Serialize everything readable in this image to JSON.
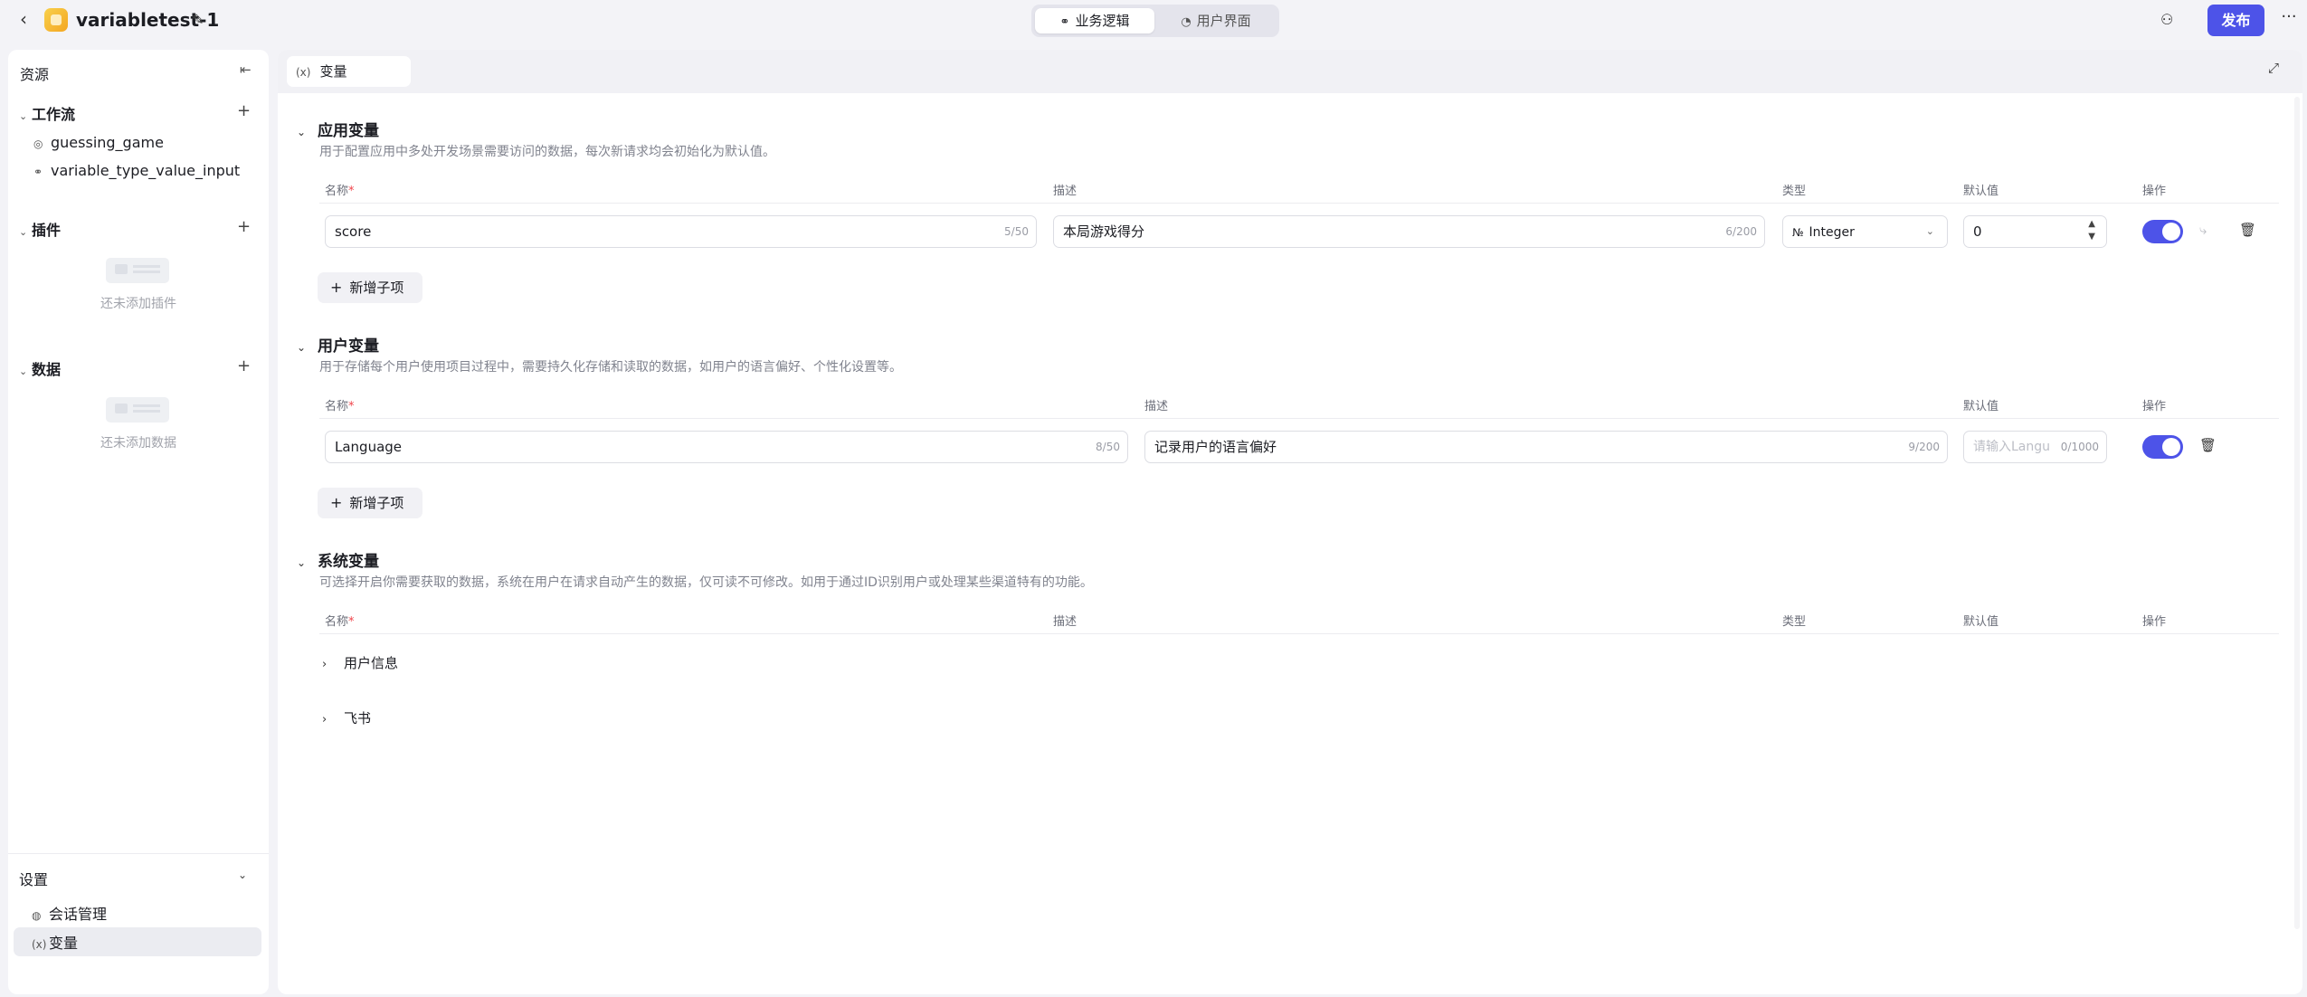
{
  "header": {
    "back": "‹",
    "app_title": "variabletest-1",
    "tabs": [
      {
        "label": "业务逻辑",
        "icon": "workflow-icon"
      },
      {
        "label": "用户界面",
        "icon": "palette-icon"
      }
    ],
    "publish_label": "发布",
    "more": "···"
  },
  "sidebar": {
    "title": "资源",
    "sections": [
      {
        "label": "工作流",
        "items": [
          "guessing_game",
          "variable_type_value_input"
        ]
      },
      {
        "label": "插件",
        "empty_text": "还未添加插件"
      },
      {
        "label": "数据",
        "empty_text": "还未添加数据"
      }
    ],
    "settings": {
      "label": "设置",
      "items": [
        "会话管理",
        "变量"
      ]
    }
  },
  "main": {
    "tab_label": "变量",
    "app_vars": {
      "title": "应用变量",
      "desc": "用于配置应用中多处开发场景需要访问的数据，每次新请求均会初始化为默认值。",
      "cols": {
        "name": "名称",
        "desc": "描述",
        "type": "类型",
        "default": "默认值",
        "ops": "操作"
      },
      "row": {
        "name": "score",
        "name_count": "5/50",
        "desc": "本局游戏得分",
        "desc_count": "6/200",
        "type": "Integer",
        "type_icon": "№",
        "default": "0"
      },
      "add_label": "新增子项"
    },
    "user_vars": {
      "title": "用户变量",
      "desc": "用于存储每个用户使用项目过程中，需要持久化存储和读取的数据，如用户的语言偏好、个性化设置等。",
      "cols": {
        "name": "名称",
        "desc": "描述",
        "default": "默认值",
        "ops": "操作"
      },
      "row": {
        "name": "Language",
        "name_count": "8/50",
        "desc": "记录用户的语言偏好",
        "desc_count": "9/200",
        "default_placeholder": "请输入Langu",
        "default_count": "0/1000"
      },
      "add_label": "新增子项"
    },
    "sys_vars": {
      "title": "系统变量",
      "desc": "可选择开启你需要获取的数据，系统在用户在请求自动产生的数据，仅可读不可修改。如用于通过ID识别用户或处理某些渠道特有的功能。",
      "cols": {
        "name": "名称",
        "desc": "描述",
        "type": "类型",
        "default": "默认值",
        "ops": "操作"
      },
      "groups": [
        "用户信息",
        "飞书"
      ]
    }
  },
  "colors": {
    "accent": "#4d53e8",
    "required": "#f0454b"
  }
}
